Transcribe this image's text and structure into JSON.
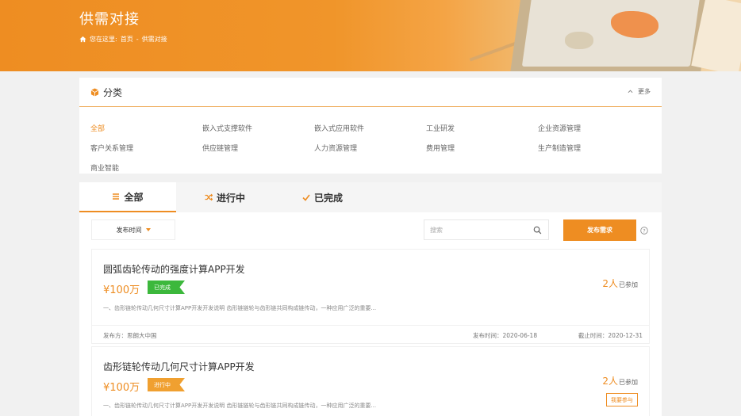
{
  "banner": {
    "title": "供需对接",
    "breadcrumb_prefix": "您在这里:",
    "breadcrumb_home": "首页",
    "breadcrumb_sep": "-",
    "breadcrumb_current": "供需对接"
  },
  "category": {
    "title": "分类",
    "more": "更多",
    "items": [
      "全部",
      "嵌入式支撑软件",
      "嵌入式应用软件",
      "工业研发",
      "企业资源管理",
      "客户关系管理",
      "供应链管理",
      "人力资源管理",
      "费用管理",
      "生产制造管理",
      "商业智能"
    ]
  },
  "tabs": [
    {
      "label": "全部",
      "icon": "list-icon"
    },
    {
      "label": "进行中",
      "icon": "shuffle-icon"
    },
    {
      "label": "已完成",
      "icon": "check-icon"
    }
  ],
  "toolbar": {
    "sort_label": "发布时间",
    "search_placeholder": "搜索",
    "publish_label": "发布需求"
  },
  "items": [
    {
      "title": "圆弧齿轮传动的强度计算APP开发",
      "price": "¥100万",
      "status": "已完成",
      "desc": "一、齿形链轮传动几何尺寸计算APP开发开发说明 齿形链链轮与齿形链共同构成链传动，一种应用广泛的重要...",
      "count": "2人",
      "count_suffix": "已参加",
      "publisher": "发布方：思朗大中国",
      "pub_date": "发布时间：2020-06-18",
      "end_date": "截止时间：2020-12-31"
    },
    {
      "title": "齿形链轮传动几何尺寸计算APP开发",
      "price": "¥100万",
      "status": "进行中",
      "desc": "一、齿形链轮传动几何尺寸计算APP开发开发说明 齿形链链轮与齿形链共同构成链传动，一种应用广泛的重要...",
      "count": "2人",
      "count_suffix": "已参加",
      "join_label": "我要参与"
    }
  ],
  "colors": {
    "accent": "#ee8d22",
    "done": "#3cb83c",
    "going": "#f0a030"
  }
}
